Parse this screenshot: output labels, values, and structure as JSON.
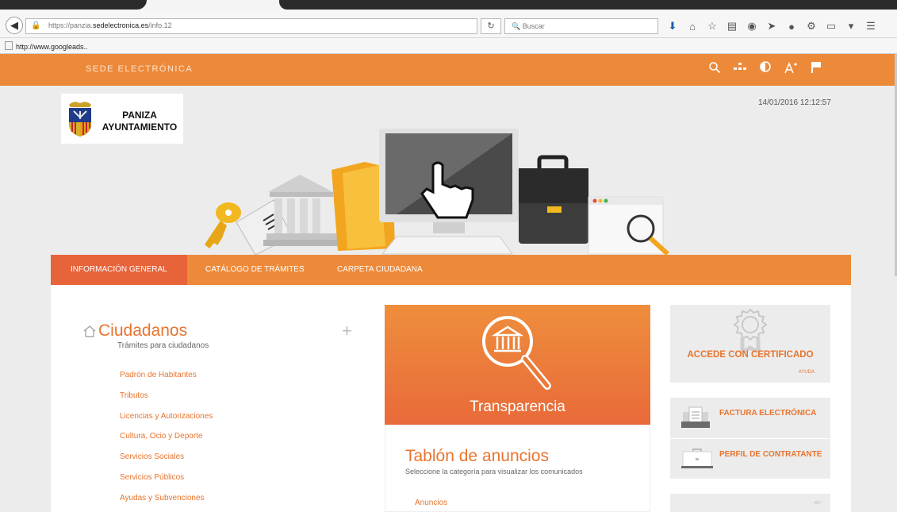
{
  "browser": {
    "url_prefix": "https://panzia.",
    "url_domain": "sedelectronica.es",
    "url_suffix": "/info.12",
    "search_placeholder": "Buscar",
    "bookmark": "http://www.googleads..",
    "icons": [
      "download-icon",
      "home-icon",
      "star-icon",
      "reader-icon",
      "pocket-icon",
      "send-icon",
      "chat-icon",
      "extension-icon",
      "doc-icon",
      "menu-icon"
    ]
  },
  "header": {
    "title": "SEDE ELECTRÓNICA",
    "tools": [
      "search-icon",
      "sitemap-icon",
      "contrast-icon",
      "font-size-icon",
      "flag-icon"
    ]
  },
  "logo": {
    "line1": "PANIZA",
    "line2": "AYUNTAMIENTO"
  },
  "datetime": "14/01/2016 12:12:57",
  "nav": {
    "items": [
      "INFORMACIÓN GENERAL",
      "CATÁLOGO DE TRÁMITES",
      "CARPETA CIUDADANA"
    ],
    "active_index": 0
  },
  "ciudadanos": {
    "title": "Ciudadanos",
    "subtitle": "Trámites para ciudadanos",
    "items": [
      "Padrón de Habitantes",
      "Tributos",
      "Licencias y Autorizaciones",
      "Cultura, Ocio y Deporte",
      "Servicios Sociales",
      "Servicios Públicos",
      "Ayudas y Subvenciones"
    ]
  },
  "transparencia": {
    "label": "Transparencia"
  },
  "tablon": {
    "title": "Tablón de anuncios",
    "subtitle": "Seleccione la categoría para visualizar los comunicados",
    "first_item": "Anuncios"
  },
  "certificado": {
    "label": "ACCEDE CON CERTIFICADO",
    "help": "AYUDA"
  },
  "links": [
    "FACTURA ELECTRÓNICA",
    "PERFIL DE CONTRATANTE"
  ],
  "colors": {
    "accent": "#ed8a3a",
    "active_tab": "#e7633a",
    "link": "#e8742e"
  }
}
